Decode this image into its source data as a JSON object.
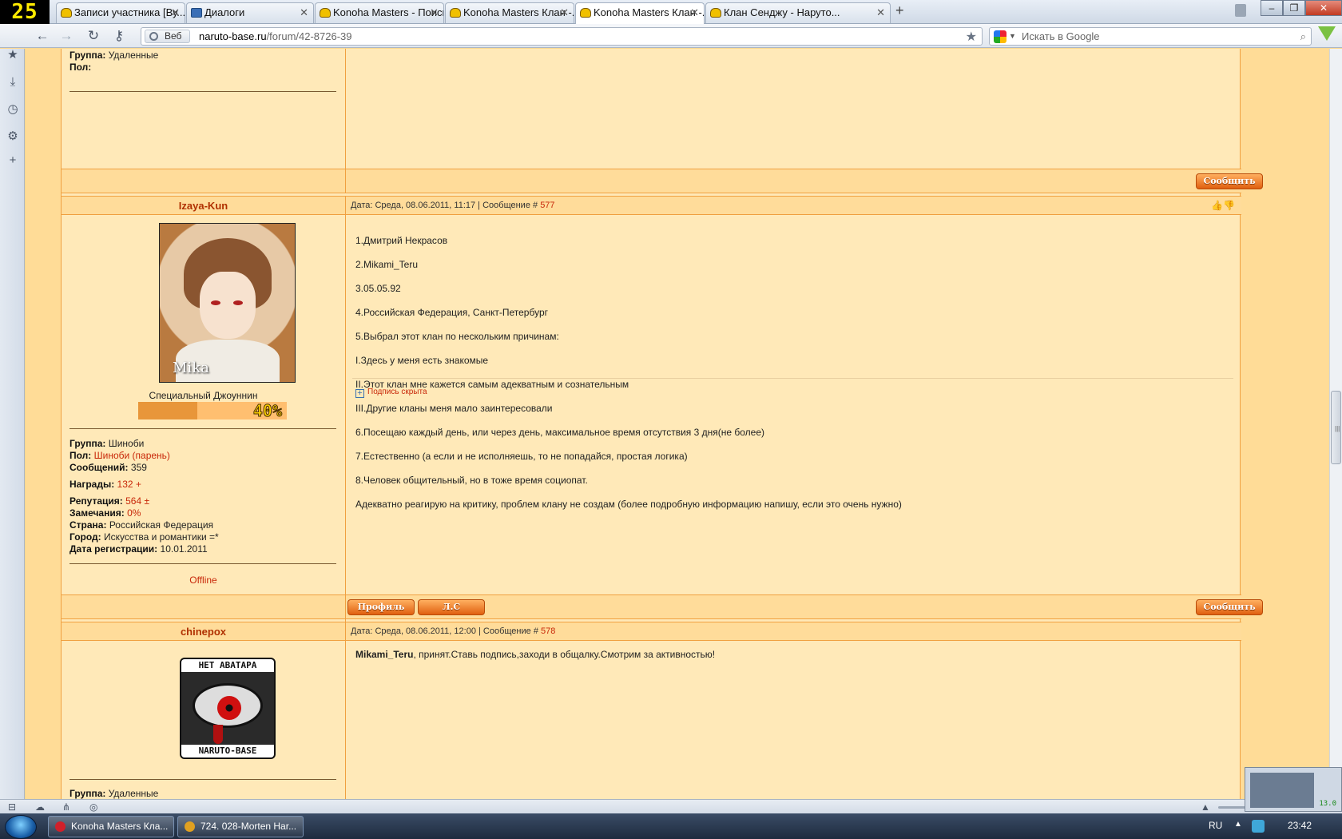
{
  "overlay": {
    "fps": "25"
  },
  "tabs": [
    {
      "label": "Записи участника [Ву...",
      "icon": "naruto-helmet-icon"
    },
    {
      "label": "Диалоги",
      "icon": "dialog-icon"
    },
    {
      "label": "Konoha Masters - Поиск",
      "icon": "naruto-helmet-icon"
    },
    {
      "label": "Konoha Masters Клан -...",
      "icon": "naruto-helmet-icon"
    },
    {
      "label": "Konoha Masters Клан -...",
      "icon": "naruto-helmet-icon",
      "active": true
    },
    {
      "label": "Клан Сенджу - Наруто...",
      "icon": "naruto-helmet-icon"
    }
  ],
  "nav": {
    "web_label": "Веб",
    "url_domain": "naruto-base.ru",
    "url_path": "/forum/42-8726-39",
    "search_placeholder": "Искать в Google"
  },
  "post_prev": {
    "info": [
      {
        "label": "Группа:",
        "value": "Удаленные"
      },
      {
        "label": "Пол:",
        "value": ""
      }
    ],
    "reply_label": "Сообщить"
  },
  "post1": {
    "username": "Izaya-Kun",
    "date": "Дата: Среда, 08.06.2011, 11:17 | Сообщение #",
    "number": "577",
    "avatar_tag": "Mika",
    "rank": "Специальный Джоуннин",
    "rank_percent": 40,
    "rank_percent_label": "40%",
    "info": {
      "group_label": "Группа:",
      "group": "Шиноби",
      "gender_label": "Пол:",
      "gender": "Шиноби (парень)",
      "messages_label": "Сообщений:",
      "messages": "359",
      "awards_label": "Награды:",
      "awards": "132",
      "awards_action": "+",
      "rep_label": "Репутация:",
      "rep": "564",
      "rep_action": "±",
      "warn_label": "Замечания:",
      "warn": "0%",
      "country_label": "Страна:",
      "country": "Российская Федерация",
      "city_label": "Город:",
      "city": "Искусства и романтики =*",
      "reg_label": "Дата регистрации:",
      "reg": "10.01.2011"
    },
    "status": "Offline",
    "text_lines": [
      "1.Дмитрий Некрасов",
      "2.Mikami_Teru",
      "3.05.05.92",
      "4.Российская Федерация, Санкт-Петербург",
      "5.Выбрал этот клан по нескольким причинам:",
      "I.Здесь у меня есть знакомые",
      "II.Этот клан мне кажется самым адекватным и сознательным",
      "III.Другие кланы меня мало заинтересовали",
      "6.Посещаю каждый день, или через день, максимальное время отсутствия 3 дня(не более)",
      "7.Естественно (а если и не исполняешь, то не попадайся, простая логика)",
      "8.Человек общительный, но в тоже время социопат.",
      "Адекватно реагирую на критику, проблем клану не создам (более подробную информацию напишу, если это очень нужно)"
    ],
    "signature_toggle": "Подпись скрыта",
    "profile_label": "Профиль",
    "pm_label": "Л.С",
    "reply_label": "Сообщить"
  },
  "post2": {
    "username": "chinepox",
    "date": "Дата: Среда, 08.06.2011, 12:00 | Сообщение #",
    "number": "578",
    "avatar_top": "НЕТ АВАТАРА",
    "avatar_bottom": "NARUTO-BASE",
    "text_bold": "Mikami_Teru",
    "text_rest": ", принят.Ставь подпись,заходи в общалку.Смотрим за активностью!",
    "group_label": "Группа:",
    "group": "Удаленные"
  },
  "thumbnail": {
    "meter": "13.0"
  },
  "taskbar": {
    "items": [
      {
        "label": "Konoha Masters Кла...",
        "icon": "opera-icon"
      },
      {
        "label": "724. 028-Morten Har...",
        "icon": "winamp-icon"
      }
    ],
    "lang": "RU",
    "time": "23:42"
  }
}
